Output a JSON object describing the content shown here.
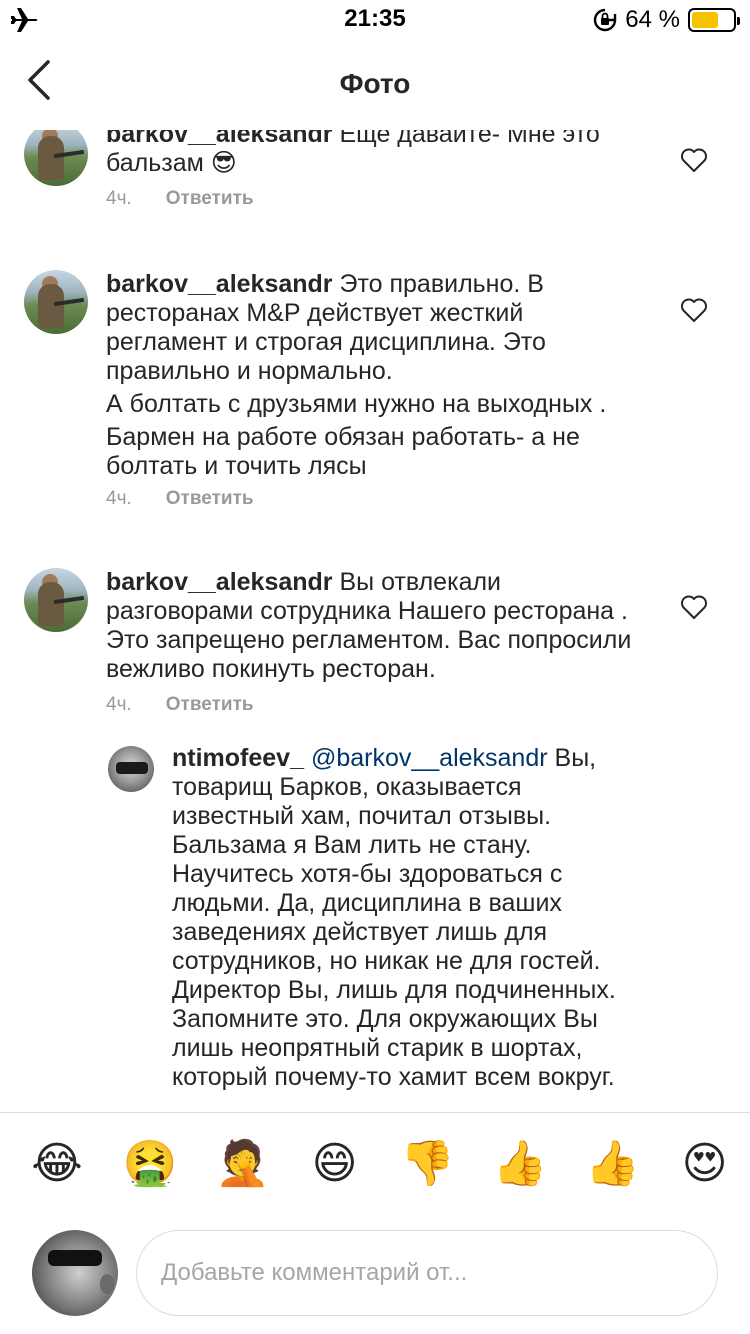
{
  "status_bar": {
    "time": "21:35",
    "battery_percent_text": "64 %",
    "battery_level": 0.64,
    "battery_color": "#f5c400",
    "icons": [
      "airplane-icon",
      "rotation-lock-icon",
      "battery-icon"
    ]
  },
  "nav": {
    "title": "Фото",
    "back_icon": "chevron-left-icon"
  },
  "comments": [
    {
      "username": "barkov__aleksandr",
      "paragraphs": [
        "Еще давайте- Мне это бальзам 😎"
      ],
      "time": "4ч.",
      "reply_label": "Ответить",
      "avatar": "avatar-hunter"
    },
    {
      "username": "barkov__aleksandr",
      "paragraphs": [
        "Это правильно. В ресторанах M&P действует жесткий регламент и строгая дисциплина. Это правильно и нормально.",
        "А болтать с друзьями нужно на выходных .",
        "Бармен на работе обязан работать- а не болтать и точить лясы"
      ],
      "time": "4ч.",
      "reply_label": "Ответить",
      "avatar": "avatar-hunter"
    },
    {
      "username": "barkov__aleksandr",
      "paragraphs": [
        "Вы отвлекали разговорами сотрудника Нашего ресторана . Это запрещено регламентом. Вас попросили вежливо покинуть ресторан."
      ],
      "time": "4ч.",
      "reply_label": "Ответить",
      "avatar": "avatar-hunter"
    }
  ],
  "reply": {
    "username": "ntimofeev_",
    "mention": "@barkov__aleksandr",
    "text": "Вы, товарищ Барков, оказывается известный хам, почитал отзывы. Бальзама я Вам лить не стану. Научитесь хотя-бы здороваться с людьми. Да, дисциплина в ваших заведениях действует лишь для сотрудников, но никак не для гостей. Директор Вы, лишь для подчиненных. Запомните это. Для окружающих Вы лишь неопрятный старик в шортах, который почему-то хамит всем вокруг.",
    "avatar": "avatar-grey"
  },
  "emoji_bar": [
    "😂",
    "🤮",
    "🤦",
    "😄",
    "👎",
    "👍",
    "👍",
    "😍"
  ],
  "emoji_names": [
    "joy-emoji",
    "vomiting-emoji",
    "facepalm-emoji",
    "grinning-emoji",
    "thumbs-down-emoji",
    "thumbs-up-light-emoji",
    "thumbs-up-medium-emoji",
    "heart-eyes-emoji"
  ],
  "input": {
    "placeholder": "Добавьте комментарий от..."
  }
}
